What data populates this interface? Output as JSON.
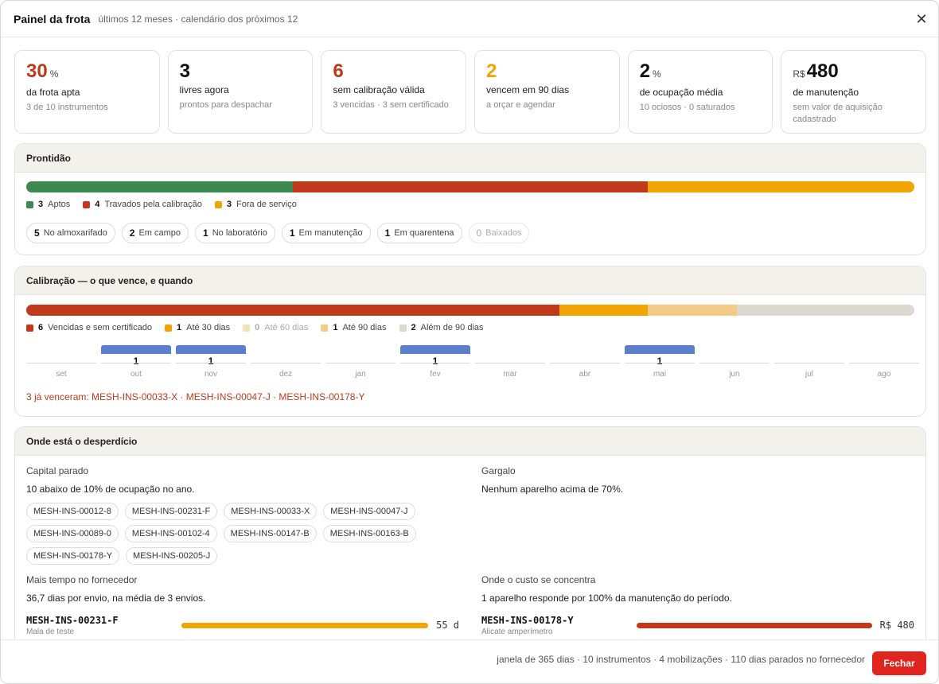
{
  "header": {
    "title": "Painel da frota",
    "subtitle": "últimos 12 meses · calendário dos próximos 12"
  },
  "kpis": [
    {
      "value": "30",
      "prefix": "",
      "unit": "%",
      "label": "da frota apta",
      "note": "3 de 10 instrumentos",
      "color": "#c0391b"
    },
    {
      "value": "3",
      "prefix": "",
      "unit": "",
      "label": "livres agora",
      "note": "prontos para despachar",
      "color": "#111111"
    },
    {
      "value": "6",
      "prefix": "",
      "unit": "",
      "label": "sem calibração válida",
      "note": "3 vencidas · 3 sem certificado",
      "color": "#c0391b"
    },
    {
      "value": "2",
      "prefix": "",
      "unit": "",
      "label": "vencem em 90 dias",
      "note": "a orçar e agendar",
      "color": "#f0a500"
    },
    {
      "value": "2",
      "prefix": "",
      "unit": "%",
      "label": "de ocupação média",
      "note": "10 ociosos · 0 saturados",
      "color": "#111111"
    },
    {
      "value": "480",
      "prefix": "R$",
      "unit": "",
      "label": "de manutenção",
      "note": "sem valor de aquisição cadastrado",
      "color": "#111111"
    }
  ],
  "readiness": {
    "title": "Prontidão",
    "segments": [
      {
        "count": "3",
        "label": "Aptos",
        "value": 3,
        "color": "#3c8a4f"
      },
      {
        "count": "4",
        "label": "Travados pela calibração",
        "value": 4,
        "color": "#c0391b"
      },
      {
        "count": "3",
        "label": "Fora de serviço",
        "value": 3,
        "color": "#f0a500"
      }
    ],
    "locations": [
      {
        "count": "5",
        "label": "No almoxarifado",
        "dim": false
      },
      {
        "count": "2",
        "label": "Em campo",
        "dim": false
      },
      {
        "count": "1",
        "label": "No laboratório",
        "dim": false
      },
      {
        "count": "1",
        "label": "Em manutenção",
        "dim": false
      },
      {
        "count": "1",
        "label": "Em quarentena",
        "dim": false
      },
      {
        "count": "0",
        "label": "Baixados",
        "dim": true
      }
    ]
  },
  "calibration": {
    "title": "Calibração — o que vence, e quando",
    "segments": [
      {
        "count": "6",
        "label": "Vencidas e sem certificado",
        "value": 6,
        "color": "#c0391b",
        "dim": false
      },
      {
        "count": "1",
        "label": "Até 30 dias",
        "value": 1,
        "color": "#f0a500",
        "dim": false
      },
      {
        "count": "0",
        "label": "Até 60 dias",
        "value": 0,
        "color": "#f6e2b8",
        "dim": true
      },
      {
        "count": "1",
        "label": "Até 90 dias",
        "value": 1,
        "color": "#f2cc86",
        "dim": false
      },
      {
        "count": "2",
        "label": "Além de 90 dias",
        "value": 2,
        "color": "#dcd9d0",
        "dim": false
      }
    ],
    "months": [
      {
        "label": "set",
        "count": ""
      },
      {
        "label": "out",
        "count": "1"
      },
      {
        "label": "nov",
        "count": "1"
      },
      {
        "label": "dez",
        "count": ""
      },
      {
        "label": "jan",
        "count": ""
      },
      {
        "label": "fev",
        "count": "1"
      },
      {
        "label": "mar",
        "count": ""
      },
      {
        "label": "abr",
        "count": ""
      },
      {
        "label": "mai",
        "count": "1"
      },
      {
        "label": "jun",
        "count": ""
      },
      {
        "label": "jul",
        "count": ""
      },
      {
        "label": "ago",
        "count": ""
      }
    ],
    "overdue": "3 já venceram: MESH-INS-00033-X · MESH-INS-00047-J · MESH-INS-00178-Y"
  },
  "waste": {
    "title": "Onde está o desperdício",
    "idle": {
      "title": "Capital parado",
      "text": "10 abaixo de 10% de ocupação no ano.",
      "tags": [
        "MESH-INS-00012-8",
        "MESH-INS-00231-F",
        "MESH-INS-00033-X",
        "MESH-INS-00047-J",
        "MESH-INS-00089-0",
        "MESH-INS-00102-4",
        "MESH-INS-00147-B",
        "MESH-INS-00163-B",
        "MESH-INS-00178-Y",
        "MESH-INS-00205-J"
      ]
    },
    "bottleneck": {
      "title": "Gargalo",
      "text": "Nenhum aparelho acima de 70%."
    },
    "supplier": {
      "title": "Mais tempo no fornecedor",
      "text": "36,7 dias por envio, na média de 3 envios.",
      "top": {
        "id": "MESH-INS-00231-F",
        "desc": "Mala de teste",
        "value": "55 d",
        "color": "#f0a500"
      }
    },
    "cost": {
      "title": "Onde o custo se concentra",
      "text": "1 aparelho responde por 100% da manutenção do período.",
      "top": {
        "id": "MESH-INS-00178-Y",
        "desc": "Alicate amperímetro",
        "value": "R$ 480",
        "color": "#c0391b"
      }
    }
  },
  "footer": {
    "summary": "janela de 365 dias · 10 instrumentos · 4 mobilizações · 110 dias parados no fornecedor",
    "close_label": "Fechar"
  }
}
